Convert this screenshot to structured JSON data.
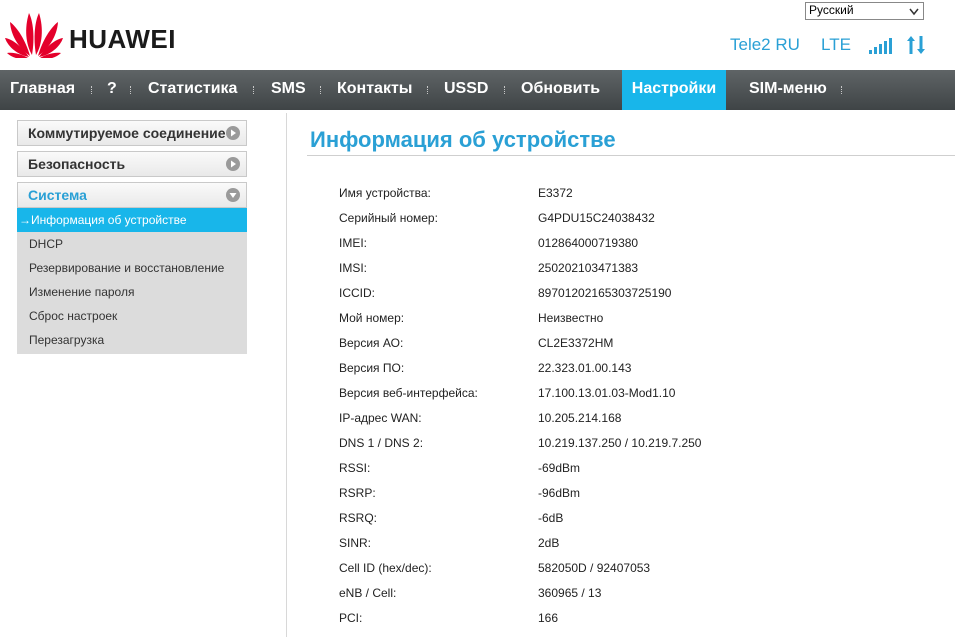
{
  "header": {
    "brand": "HUAWEI",
    "language": "Русский",
    "operator": "Tele2 RU",
    "network_type": "LTE",
    "signal_level": 5,
    "signal_max": 5,
    "accent_color": "#2aa0d5"
  },
  "nav": {
    "items": [
      {
        "label": "Главная"
      },
      {
        "label": "?"
      },
      {
        "label": "Статистика"
      },
      {
        "label": "SMS"
      },
      {
        "label": "Контакты"
      },
      {
        "label": "USSD"
      },
      {
        "label": "Обновить"
      },
      {
        "label": "Настройки",
        "active": true
      },
      {
        "label": "SIM-меню"
      }
    ],
    "active_color": "#18b6ea"
  },
  "sidebar": {
    "sections": [
      {
        "label": "Коммутируемое соединение"
      },
      {
        "label": "Безопасность"
      },
      {
        "label": "Система",
        "open": true
      }
    ],
    "submenu": [
      {
        "label": "Информация об устройстве",
        "active": true,
        "arrow": "→"
      },
      {
        "label": "DHCP"
      },
      {
        "label": "Резервирование и восстановление"
      },
      {
        "label": "Изменение пароля"
      },
      {
        "label": "Сброс настроек"
      },
      {
        "label": "Перезагрузка"
      }
    ]
  },
  "main": {
    "title": "Информация об устройстве",
    "rows": [
      {
        "label": "Имя устройства:",
        "value": "E3372"
      },
      {
        "label": "Серийный номер:",
        "value": "G4PDU15C24038432"
      },
      {
        "label": "IMEI:",
        "value": "012864000719380"
      },
      {
        "label": "IMSI:",
        "value": "250202103471383"
      },
      {
        "label": "ICCID:",
        "value": "89701202165303725190"
      },
      {
        "label": "Мой номер:",
        "value": "Неизвестно"
      },
      {
        "label": "Версия АО:",
        "value": "CL2E3372HM"
      },
      {
        "label": "Версия ПО:",
        "value": "22.323.01.00.143"
      },
      {
        "label": "Версия веб-интерфейса:",
        "value": "17.100.13.01.03-Mod1.10"
      },
      {
        "label": "IP-адрес WAN:",
        "value": "10.205.214.168"
      },
      {
        "label": "DNS 1 / DNS 2:",
        "value": "10.219.137.250 / 10.219.7.250"
      },
      {
        "label": "RSSI:",
        "value": "-69dBm"
      },
      {
        "label": "RSRP:",
        "value": "-96dBm"
      },
      {
        "label": "RSRQ:",
        "value": "-6dB"
      },
      {
        "label": "SINR:",
        "value": "2dB"
      },
      {
        "label": "Cell ID (hex/dec):",
        "value": "582050D / 92407053"
      },
      {
        "label": "eNB / Cell:",
        "value": "360965 / 13"
      },
      {
        "label": "PCI:",
        "value": "166"
      }
    ]
  }
}
